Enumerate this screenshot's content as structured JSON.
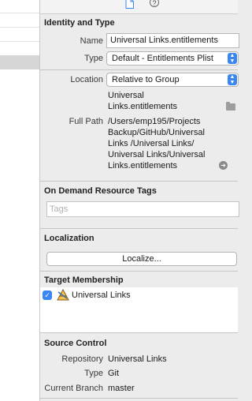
{
  "toolbar": {
    "help_glyph": "?"
  },
  "identity": {
    "title": "Identity and Type",
    "name_label": "Name",
    "name_value": "Universal Links.entitlements",
    "type_label": "Type",
    "type_value": "Default - Entitlements Plist",
    "location_label": "Location",
    "location_value": "Relative to Group",
    "location_file_line1": "Universal",
    "location_file_line2": "Links.entitlements",
    "fullpath_label": "Full Path",
    "fullpath_lines": [
      "/Users/emp195/Projects",
      "Backup/GitHub/Universal",
      "Links /Universal Links/",
      "Universal Links/Universal",
      "Links.entitlements"
    ]
  },
  "on_demand": {
    "title": "On Demand Resource Tags",
    "placeholder": "Tags"
  },
  "localization": {
    "title": "Localization",
    "button_label": "Localize..."
  },
  "target_membership": {
    "title": "Target Membership",
    "items": [
      {
        "label": "Universal Links",
        "checked": true
      }
    ]
  },
  "source_control": {
    "title": "Source Control",
    "repository_label": "Repository",
    "repository_value": "Universal Links",
    "type_label": "Type",
    "type_value": "Git",
    "branch_label": "Current Branch",
    "branch_value": "master"
  },
  "icons": {
    "file": "document-icon",
    "help": "help-icon",
    "folder": "folder-icon",
    "reveal": "reveal-arrow-icon",
    "target": "xcode-target-icon"
  },
  "colors": {
    "accent": "#3b86f0",
    "panel": "#ececec"
  }
}
